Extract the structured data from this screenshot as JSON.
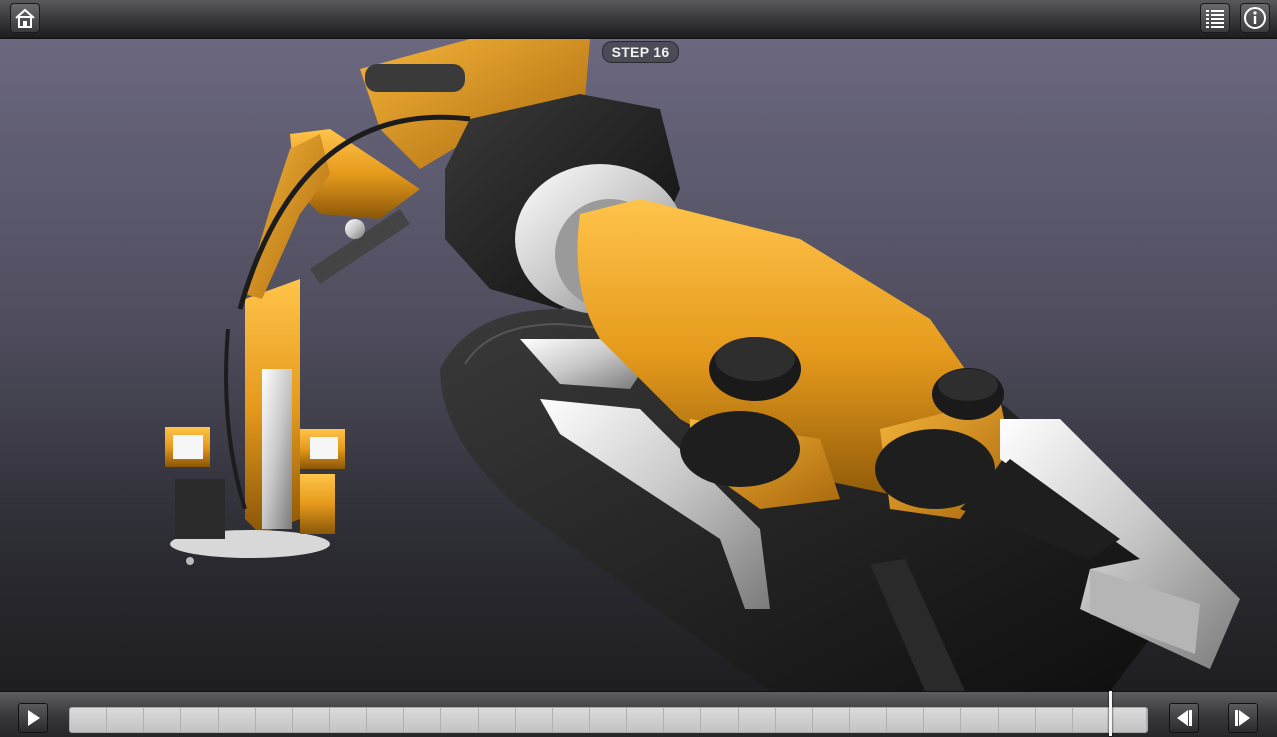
{
  "toolbar": {
    "home_icon": "home-icon",
    "steps_list_icon": "list-icon",
    "info_icon": "info-icon"
  },
  "viewer": {
    "step_label": "STEP 16"
  },
  "playback": {
    "play_icon": "play-icon",
    "prev_step_icon": "step-back-icon",
    "next_step_icon": "step-forward-icon",
    "timeline_progress": 0.965
  },
  "colors": {
    "model_orange": "#e59a1c",
    "model_black": "#1a1a1a",
    "model_silver": "#d0d0d0",
    "background_top": "#6b6880",
    "background_bottom": "#1e1e22"
  }
}
